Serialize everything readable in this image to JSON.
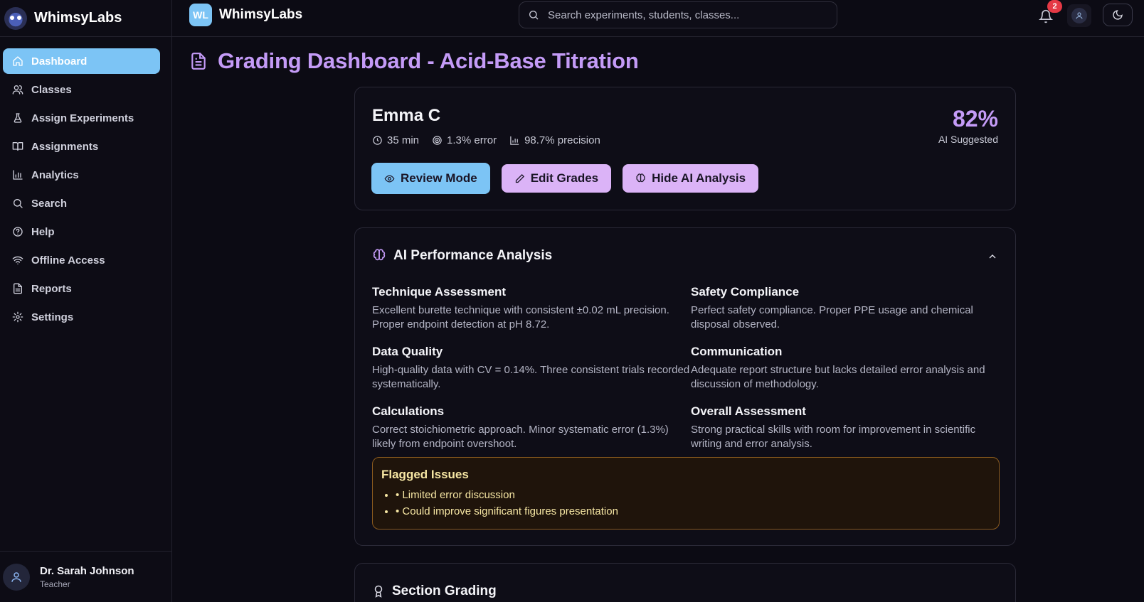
{
  "sidebar": {
    "brand": "WhimsyLabs",
    "items": [
      {
        "label": "Dashboard",
        "icon": "home-icon"
      },
      {
        "label": "Classes",
        "icon": "users-icon"
      },
      {
        "label": "Assign Experiments",
        "icon": "flask-icon"
      },
      {
        "label": "Assignments",
        "icon": "book-icon"
      },
      {
        "label": "Analytics",
        "icon": "bar-chart-icon"
      },
      {
        "label": "Search",
        "icon": "search-icon"
      },
      {
        "label": "Help",
        "icon": "help-icon"
      },
      {
        "label": "Offline Access",
        "icon": "wifi-icon"
      },
      {
        "label": "Reports",
        "icon": "file-icon"
      },
      {
        "label": "Settings",
        "icon": "gear-icon"
      }
    ],
    "active_item": "Dashboard",
    "user": {
      "name": "Dr. Sarah Johnson",
      "role": "Teacher"
    }
  },
  "topbar": {
    "badge_initials": "WL",
    "brand": "WhimsyLabs",
    "search_placeholder": "Search experiments, students, classes...",
    "notification_count": "2"
  },
  "page": {
    "title": "Grading Dashboard - Acid-Base Titration"
  },
  "student": {
    "name": "Emma C",
    "time": "35 min",
    "error": "1.3% error",
    "precision": "98.7% precision",
    "score": "82%",
    "score_label": "AI Suggested",
    "buttons": {
      "review": "Review Mode",
      "edit": "Edit Grades",
      "hide_ai": "Hide AI Analysis"
    }
  },
  "ai_analysis": {
    "title": "AI Performance Analysis",
    "sections": [
      {
        "title": "Technique Assessment",
        "text": "Excellent burette technique with consistent ±0.02 mL precision. Proper endpoint detection at pH 8.72."
      },
      {
        "title": "Safety Compliance",
        "text": "Perfect safety compliance. Proper PPE usage and chemical disposal observed."
      },
      {
        "title": "Data Quality",
        "text": "High-quality data with CV = 0.14%. Three consistent trials recorded systematically."
      },
      {
        "title": "Communication",
        "text": "Adequate report structure but lacks detailed error analysis and discussion of methodology."
      },
      {
        "title": "Calculations",
        "text": "Correct stoichiometric approach. Minor systematic error (1.3%) likely from endpoint overshoot."
      },
      {
        "title": "Overall Assessment",
        "text": "Strong practical skills with room for improvement in scientific writing and error analysis."
      }
    ],
    "flagged": {
      "title": "Flagged Issues",
      "items": [
        "• Limited error discussion",
        "• Could improve significant figures presentation"
      ]
    }
  },
  "section_grading": {
    "title": "Section Grading"
  },
  "colors": {
    "accent_purple": "#c49bf7",
    "accent_blue": "#7cc4f5",
    "button_purple": "#dbb3f7",
    "warning_border": "#8a5a1e",
    "badge_red": "#e53945"
  }
}
